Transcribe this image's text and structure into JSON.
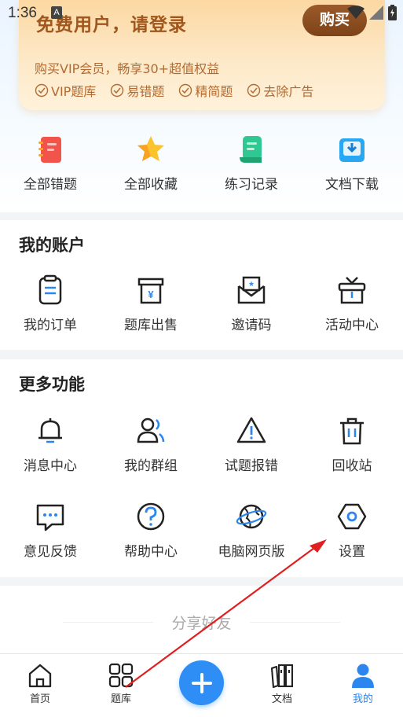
{
  "status": {
    "time": "1:36",
    "notif_letter": "A"
  },
  "vip": {
    "title": "免费用户，请登录",
    "buy_label": "购买",
    "subtitle": "购买VIP会员，畅享30+超值权益",
    "perks": [
      "VIP题库",
      "易错题",
      "精简题",
      "去除广告"
    ]
  },
  "quick": [
    "全部错题",
    "全部收藏",
    "练习记录",
    "文档下载"
  ],
  "account": {
    "title": "我的账户",
    "items": [
      "我的订单",
      "题库出售",
      "邀请码",
      "活动中心"
    ]
  },
  "more": {
    "title": "更多功能",
    "row1": [
      "消息中心",
      "我的群组",
      "试题报错",
      "回收站"
    ],
    "row2": [
      "意见反馈",
      "帮助中心",
      "电脑网页版",
      "设置"
    ]
  },
  "share": {
    "label": "分享好友"
  },
  "nav": [
    "首页",
    "题库",
    "文档",
    "我的"
  ],
  "colors": {
    "accent": "#2b86f0",
    "vip_text": "#a0561c",
    "buy_bg": "#8b4e22"
  }
}
